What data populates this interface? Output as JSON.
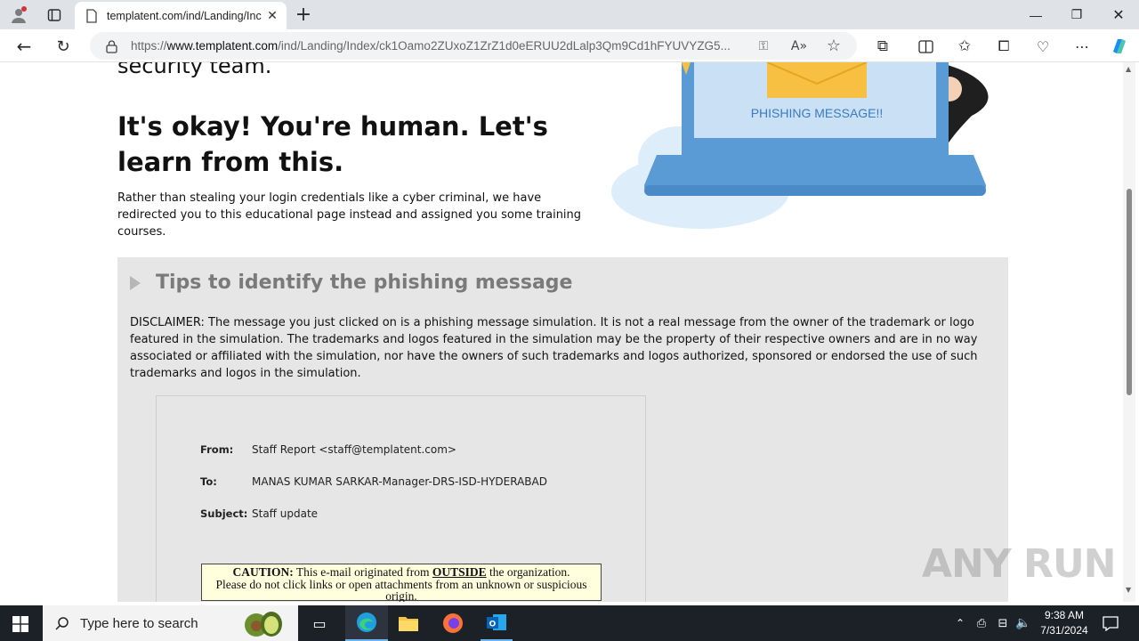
{
  "browser": {
    "tab_title": "templatent.com/ind/Landing/Inc",
    "url_prefix": "https://",
    "url_host": "www.templatent.com",
    "url_path": "/ind/Landing/Index/ck1Oamo2ZUxoZ1ZrZ1d0eERUU2dLalp3Qm9Cd1hFYUVYZG5...",
    "window_controls": [
      "minimize",
      "restore",
      "close"
    ]
  },
  "page": {
    "heading_fragment": "security team.",
    "heading": "It's okay! You're human. Let's learn from this.",
    "intro": "Rather than stealing your login credentials like a cyber criminal, we have redirected you to this educational page instead and assigned you some training courses.",
    "illustration_label": "PHISHING MESSAGE!!",
    "tips_title": "Tips to identify the phishing message",
    "disclaimer": "DISCLAIMER: The message you just clicked on is a phishing message simulation. It is not a real message from the owner of the trademark or logo featured in the simulation. The trademarks and logos featured in the simulation may be the property of their respective owners and are in no way associated or affiliated with the simulation, nor have the owners of such trademarks and logos authorized, sponsored or endorsed the use of such trademarks and logos in the simulation.",
    "email": {
      "from_label": "From:",
      "from_value": "Staff Report <staff@templatent.com>",
      "to_label": "To:",
      "to_value": "MANAS KUMAR SARKAR-Manager-DRS-ISD-HYDERABAD",
      "subject_label": "Subject:",
      "subject_value": "Staff update",
      "caution_label": "CAUTION:",
      "caution_part1": "This e-mail originated from",
      "caution_outside": "OUTSIDE",
      "caution_part2": "the organization.",
      "caution_line2": "Please do not click links or open attachments from an unknown or suspicious origin."
    }
  },
  "watermark": "ANY RUN",
  "taskbar": {
    "search_placeholder": "Type here to search",
    "time": "9:38 AM",
    "date": "7/31/2024"
  },
  "colors": {
    "laptop_blue": "#5b9bd5",
    "tips_bg": "#e6e6e6",
    "caution_bg": "#fffedd",
    "taskbar": "#1c2027"
  }
}
